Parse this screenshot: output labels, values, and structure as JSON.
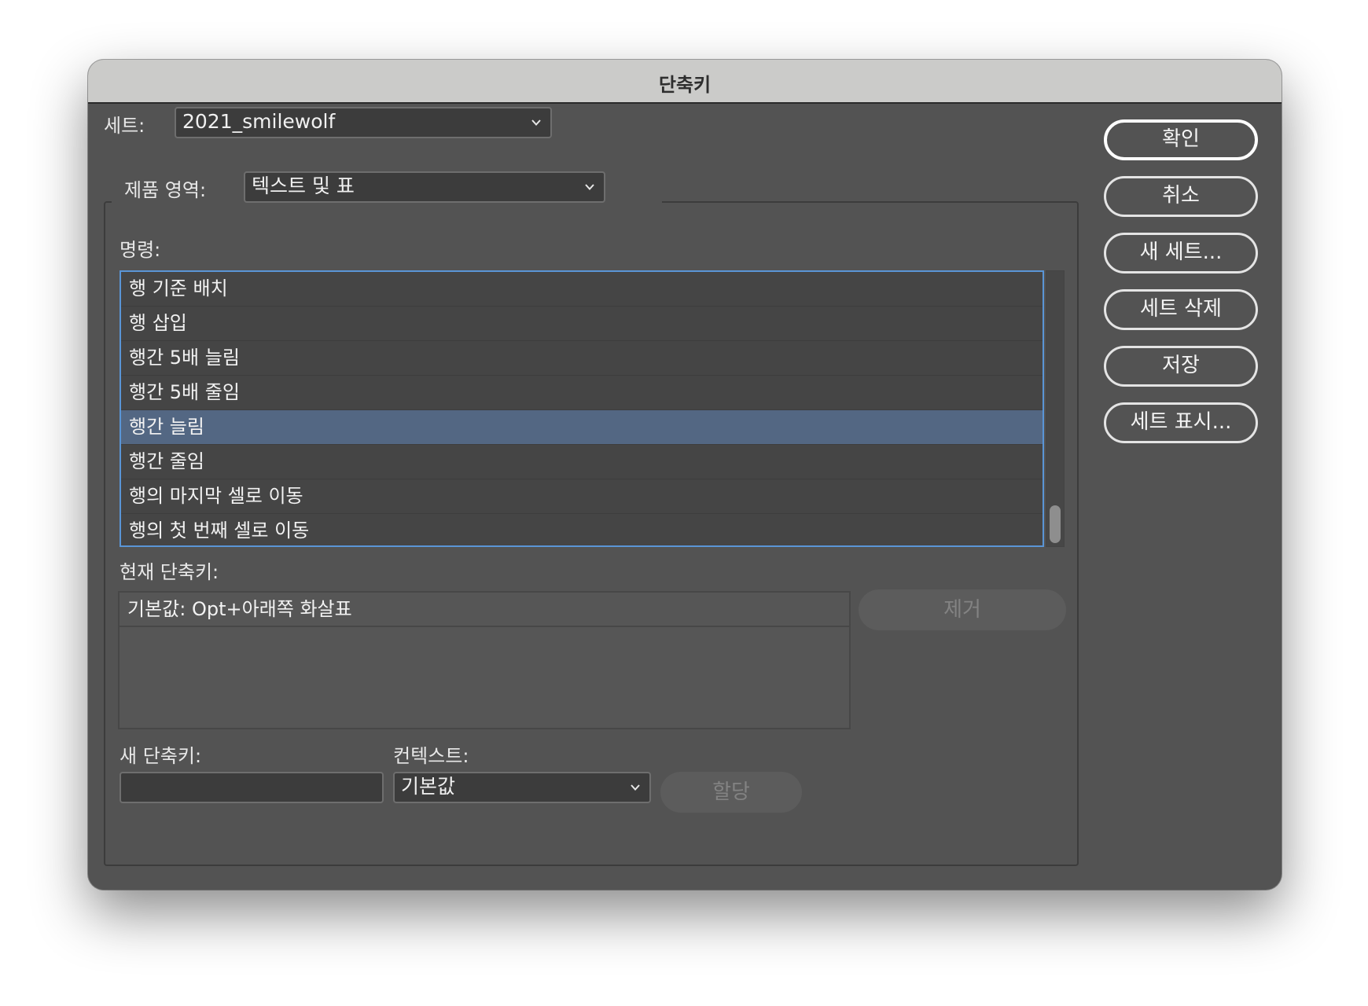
{
  "window": {
    "title": "단축키"
  },
  "set": {
    "label": "세트:",
    "value": "2021_smilewolf"
  },
  "product_area": {
    "label": "제품 영역:",
    "value": "텍스트 및 표"
  },
  "commands": {
    "label": "명령:",
    "items": [
      "행 기준 배치",
      "행 삽입",
      "행간 5배 늘림",
      "행간 5배 줄임",
      "행간 늘림",
      "행간 줄임",
      "행의 마지막 셀로 이동",
      "행의 첫 번째 셀로 이동"
    ],
    "selected_index": 4
  },
  "current_shortcut": {
    "label": "현재 단축키:",
    "items": [
      "기본값: Opt+아래쪽 화살표"
    ],
    "remove_label": "제거"
  },
  "new_shortcut": {
    "label": "새 단축키:",
    "value": ""
  },
  "context": {
    "label": "컨텍스트:",
    "value": "기본값",
    "assign_label": "할당"
  },
  "buttons": {
    "ok": "확인",
    "cancel": "취소",
    "new_set": "새 세트...",
    "delete_set": "세트 삭제",
    "save": "저장",
    "show_set": "세트 표시..."
  },
  "colors": {
    "selection": "#536783",
    "focus_ring": "#5a95d6",
    "panel": "#535353"
  }
}
